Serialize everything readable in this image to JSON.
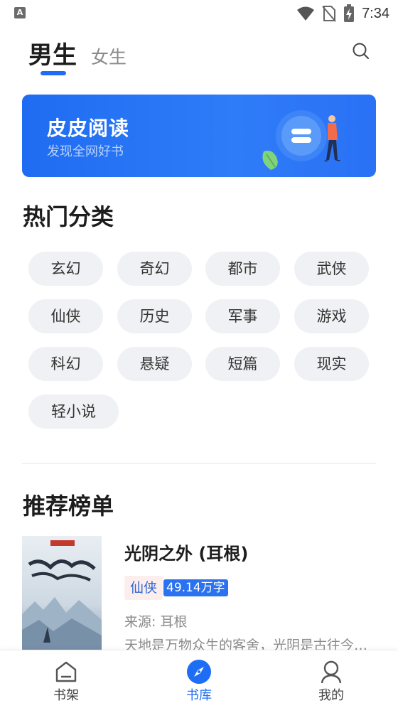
{
  "status_bar": {
    "time": "7:34",
    "app_icon_letter": "A"
  },
  "header": {
    "tabs": [
      {
        "label": "男生",
        "active": true
      },
      {
        "label": "女生",
        "active": false
      }
    ]
  },
  "banner": {
    "title": "皮皮阅读",
    "subtitle": "发现全网好书"
  },
  "categories": {
    "title": "热门分类",
    "items": [
      "玄幻",
      "奇幻",
      "都市",
      "武侠",
      "仙侠",
      "历史",
      "军事",
      "游戏",
      "科幻",
      "悬疑",
      "短篇",
      "现实",
      "轻小说"
    ]
  },
  "recommend": {
    "title": "推荐榜单",
    "books": [
      {
        "title": "光阴之外 (耳根)",
        "genre": "仙侠",
        "word_count": "49.14万字",
        "source": "来源: 耳根",
        "description": "天地是万物众生的客舍，光阴是古往今来的过客"
      }
    ]
  },
  "bottom_nav": {
    "items": [
      {
        "label": "书架",
        "active": false
      },
      {
        "label": "书库",
        "active": true
      },
      {
        "label": "我的",
        "active": false
      }
    ]
  },
  "colors": {
    "accent": "#1e6ef5",
    "chip_bg": "#f0f1f4",
    "banner_bg": "#2a71f5"
  }
}
